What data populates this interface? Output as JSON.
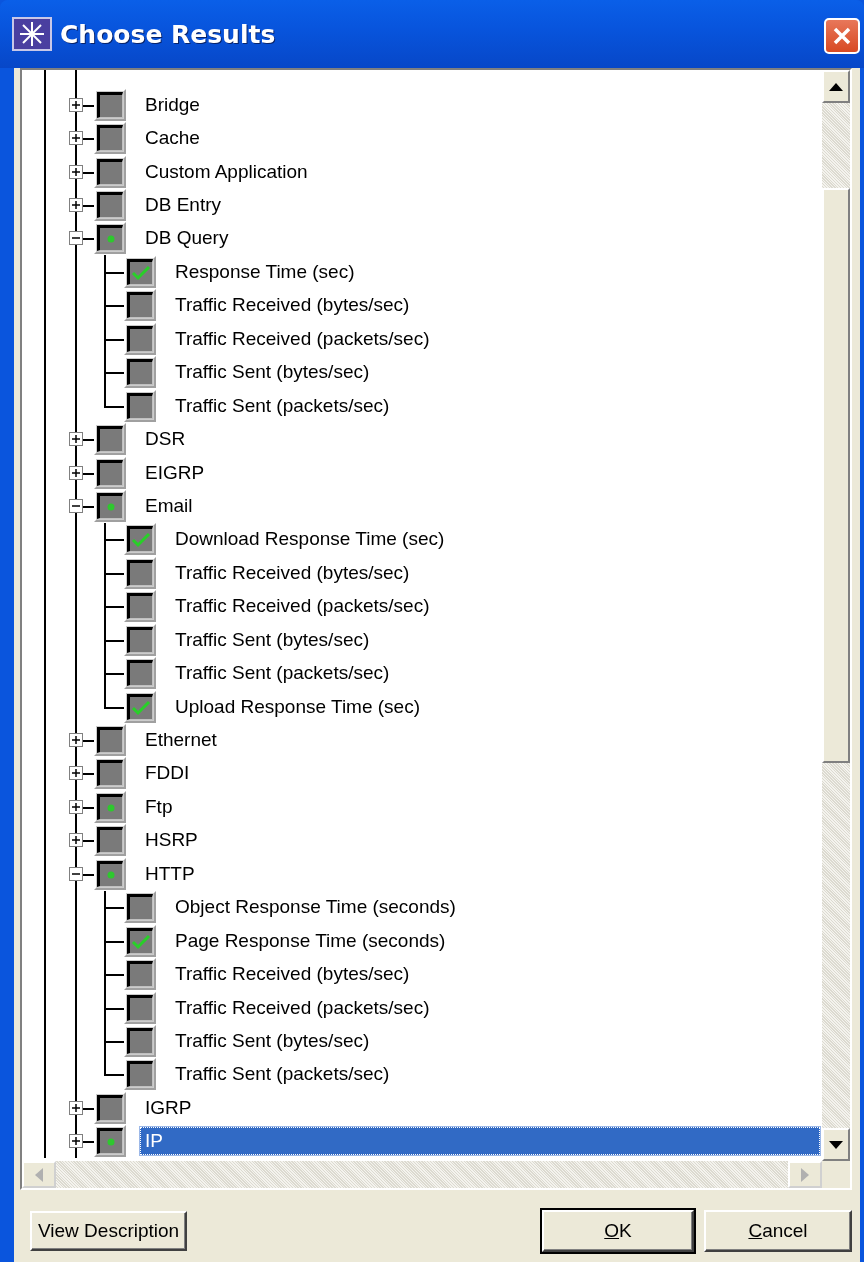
{
  "window": {
    "title": "Choose Results"
  },
  "tree": [
    {
      "label": "Bridge",
      "partially_checked": false,
      "expanded": false,
      "selected": false
    },
    {
      "label": "Cache",
      "partially_checked": false,
      "expanded": false,
      "selected": false
    },
    {
      "label": "Custom Application",
      "partially_checked": false,
      "expanded": false,
      "selected": false
    },
    {
      "label": "DB Entry",
      "partially_checked": false,
      "expanded": false,
      "selected": false
    },
    {
      "label": "DB Query",
      "partially_checked": true,
      "expanded": true,
      "selected": false,
      "children": [
        {
          "label": "Response Time (sec)",
          "checked": true,
          "selected": false
        },
        {
          "label": "Traffic Received (bytes/sec)",
          "checked": false,
          "selected": false
        },
        {
          "label": "Traffic Received (packets/sec)",
          "checked": false,
          "selected": false
        },
        {
          "label": "Traffic Sent (bytes/sec)",
          "checked": false,
          "selected": false
        },
        {
          "label": "Traffic Sent (packets/sec)",
          "checked": false,
          "selected": false
        }
      ]
    },
    {
      "label": "DSR",
      "partially_checked": false,
      "expanded": false,
      "selected": false
    },
    {
      "label": "EIGRP",
      "partially_checked": false,
      "expanded": false,
      "selected": false
    },
    {
      "label": "Email",
      "partially_checked": true,
      "expanded": true,
      "selected": false,
      "children": [
        {
          "label": "Download Response Time (sec)",
          "checked": true,
          "selected": false
        },
        {
          "label": "Traffic Received (bytes/sec)",
          "checked": false,
          "selected": false
        },
        {
          "label": "Traffic Received (packets/sec)",
          "checked": false,
          "selected": false
        },
        {
          "label": "Traffic Sent (bytes/sec)",
          "checked": false,
          "selected": false
        },
        {
          "label": "Traffic Sent (packets/sec)",
          "checked": false,
          "selected": false
        },
        {
          "label": "Upload Response Time (sec)",
          "checked": true,
          "selected": false
        }
      ]
    },
    {
      "label": "Ethernet",
      "partially_checked": false,
      "expanded": false,
      "selected": false
    },
    {
      "label": "FDDI",
      "partially_checked": false,
      "expanded": false,
      "selected": false
    },
    {
      "label": "Ftp",
      "partially_checked": true,
      "expanded": false,
      "selected": false
    },
    {
      "label": "HSRP",
      "partially_checked": false,
      "expanded": false,
      "selected": false
    },
    {
      "label": "HTTP",
      "partially_checked": true,
      "expanded": true,
      "selected": false,
      "children": [
        {
          "label": "Object Response Time (seconds)",
          "checked": false,
          "selected": false
        },
        {
          "label": "Page Response Time (seconds)",
          "checked": true,
          "selected": false
        },
        {
          "label": "Traffic Received (bytes/sec)",
          "checked": false,
          "selected": false
        },
        {
          "label": "Traffic Received (packets/sec)",
          "checked": false,
          "selected": false
        },
        {
          "label": "Traffic Sent (bytes/sec)",
          "checked": false,
          "selected": false
        },
        {
          "label": "Traffic Sent (packets/sec)",
          "checked": false,
          "selected": false
        }
      ]
    },
    {
      "label": "IGRP",
      "partially_checked": false,
      "expanded": false,
      "selected": false
    },
    {
      "label": "IP",
      "partially_checked": true,
      "expanded": false,
      "selected": true
    }
  ],
  "buttons": [
    {
      "label": "View Description",
      "default": false
    },
    {
      "label": "OK",
      "default": true
    },
    {
      "label": "Cancel",
      "default": false
    }
  ]
}
